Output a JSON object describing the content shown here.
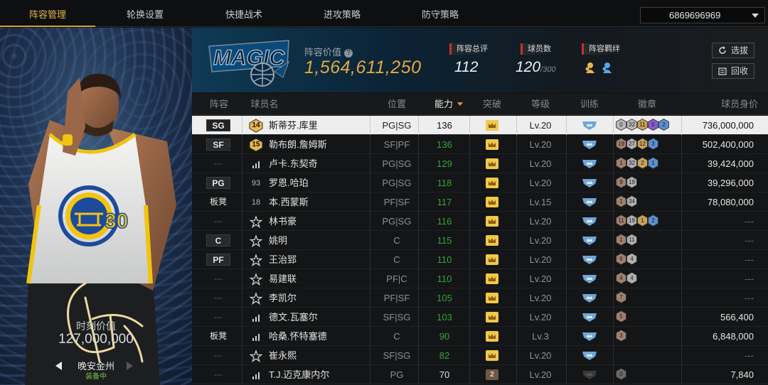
{
  "tabs": [
    {
      "label": "阵容管理",
      "active": true
    },
    {
      "label": "轮换设置",
      "active": false
    },
    {
      "label": "快捷战术",
      "active": false
    },
    {
      "label": "进攻策略",
      "active": false
    },
    {
      "label": "防守策略",
      "active": false
    }
  ],
  "account": {
    "id": "6869696969"
  },
  "card": {
    "market_value_label": "时刻价值",
    "market_value": "127,000,000",
    "name": "晚安金州",
    "status": "装备中",
    "jersey_team": "GOLDEN STATE WARRIORS",
    "jersey_number": "30"
  },
  "team": {
    "logo_text": "MAGIC",
    "lineup_value_label": "阵容价值",
    "lineup_value": "1,564,611,250",
    "overall_label": "阵容总评",
    "overall": "112",
    "player_count_label": "球员数",
    "player_count": "120",
    "player_count_max": "/300",
    "bond_label": "阵容羁绊",
    "select_button": "选拔",
    "recycle_button": "回收"
  },
  "columns": {
    "lineup": "阵容",
    "name": "球员名",
    "position": "位置",
    "rating": "能力",
    "breakthrough": "突破",
    "level": "等级",
    "training": "训练",
    "badges": "徽章",
    "value": "球员身价"
  },
  "colors": {
    "accent_gold": "#e4a93e",
    "rating_green": "#36a43b",
    "active_tab": "#e3b64a",
    "equipped_green": "#7fc241"
  },
  "players": [
    {
      "lineup": "SG",
      "lineup_style": "box",
      "badge": "14",
      "badge_type": "jersey-gold",
      "name": "斯蒂芬.库里",
      "position": "PG|SG",
      "rating": "136",
      "bt": "gold",
      "level": "Lv.20",
      "badges": [
        {
          "n": "0",
          "c": "#b9b9b9"
        },
        {
          "n": "32",
          "c": "#b9b9b9"
        },
        {
          "n": "11",
          "c": "#c9a15a"
        },
        {
          "n": "5",
          "c": "#8a5cc9"
        },
        {
          "n": "2",
          "c": "#5b8fd0"
        }
      ],
      "price": "736,000,000",
      "selected": true
    },
    {
      "lineup": "SF",
      "lineup_style": "box",
      "badge": "15",
      "badge_type": "jersey-gold",
      "name": "勒布朗.詹姆斯",
      "position": "SF|PF",
      "rating": "136",
      "bt": "gold",
      "level": "Lv.20",
      "badges": [
        {
          "n": "19",
          "c": "#a08070"
        },
        {
          "n": "27",
          "c": "#b0b0b0"
        },
        {
          "n": "12",
          "c": "#c9a15a"
        },
        {
          "n": "3",
          "c": "#5b8fd0"
        }
      ],
      "price": "502,400,000"
    },
    {
      "lineup": "---",
      "lineup_style": "dash",
      "badge": "",
      "badge_type": "signal",
      "name": "卢卡.东契奇",
      "position": "PG|SG",
      "rating": "129",
      "bt": "gold",
      "level": "Lv.20",
      "badges": [
        {
          "n": "1",
          "c": "#a08070"
        },
        {
          "n": "32",
          "c": "#b0b0b0"
        },
        {
          "n": "2",
          "c": "#c9a15a"
        },
        {
          "n": "1",
          "c": "#5b8fd0"
        }
      ],
      "price": "39,424,000"
    },
    {
      "lineup": "PG",
      "lineup_style": "box",
      "badge": "93",
      "badge_type": "number",
      "name": "罗恩.哈珀",
      "position": "PG|SG",
      "rating": "118",
      "bt": "gold",
      "level": "Lv.20",
      "badges": [
        {
          "n": "9",
          "c": "#a08070"
        },
        {
          "n": "19",
          "c": "#b0b0b0"
        }
      ],
      "price": "39,296,000"
    },
    {
      "lineup": "板凳",
      "lineup_style": "text",
      "badge": "18",
      "badge_type": "number",
      "name": "本.西蒙斯",
      "position": "PF|SF",
      "rating": "117",
      "bt": "gold",
      "level": "Lv.15",
      "badges": [
        {
          "n": "1",
          "c": "#a08070"
        },
        {
          "n": "34",
          "c": "#b0b0b0"
        }
      ],
      "price": "78,080,000"
    },
    {
      "lineup": "---",
      "lineup_style": "dash",
      "badge": "",
      "badge_type": "star",
      "name": "林书豪",
      "position": "PG|SG",
      "rating": "116",
      "bt": "gold",
      "level": "Lv.20",
      "badges": [
        {
          "n": "11",
          "c": "#a08070"
        },
        {
          "n": "19",
          "c": "#b0b0b0"
        },
        {
          "n": "1",
          "c": "#c9a15a"
        },
        {
          "n": "2",
          "c": "#5b8fd0"
        }
      ],
      "price": "---"
    },
    {
      "lineup": "C",
      "lineup_style": "box",
      "badge": "",
      "badge_type": "star",
      "name": "姚明",
      "position": "C",
      "rating": "115",
      "bt": "gold",
      "level": "Lv.20",
      "badges": [
        {
          "n": "1",
          "c": "#a08070"
        },
        {
          "n": "11",
          "c": "#b0b0b0"
        }
      ],
      "price": "---"
    },
    {
      "lineup": "PF",
      "lineup_style": "box",
      "badge": "",
      "badge_type": "star",
      "name": "王治郅",
      "position": "C",
      "rating": "110",
      "bt": "gold",
      "level": "Lv.20",
      "badges": [
        {
          "n": "6",
          "c": "#a08070"
        },
        {
          "n": "4",
          "c": "#b0b0b0"
        }
      ],
      "price": "---"
    },
    {
      "lineup": "---",
      "lineup_style": "dash",
      "badge": "",
      "badge_type": "star",
      "name": "易建联",
      "position": "PF|C",
      "rating": "110",
      "bt": "gold",
      "level": "Lv.20",
      "badges": [
        {
          "n": "4",
          "c": "#a08070"
        },
        {
          "n": "4",
          "c": "#b0b0b0"
        }
      ],
      "price": "---"
    },
    {
      "lineup": "---",
      "lineup_style": "dash",
      "badge": "",
      "badge_type": "star",
      "name": "李凯尔",
      "position": "PF|SF",
      "rating": "105",
      "bt": "gold",
      "level": "Lv.20",
      "badges": [
        {
          "n": "7",
          "c": "#a08070"
        }
      ],
      "price": "---"
    },
    {
      "lineup": "---",
      "lineup_style": "dash",
      "badge": "",
      "badge_type": "signal",
      "name": "德文.瓦塞尔",
      "position": "SF|SG",
      "rating": "103",
      "bt": "gold",
      "level": "Lv.20",
      "badges": [
        {
          "n": "5",
          "c": "#a08070"
        }
      ],
      "price": "566,400"
    },
    {
      "lineup": "板凳",
      "lineup_style": "text",
      "badge": "",
      "badge_type": "signal",
      "name": "哈桑.怀特塞德",
      "position": "C",
      "rating": "90",
      "bt": "gold",
      "level": "Lv.3",
      "badges": [
        {
          "n": "3",
          "c": "#a08070"
        }
      ],
      "price": "6,848,000"
    },
    {
      "lineup": "---",
      "lineup_style": "dash",
      "badge": "",
      "badge_type": "star",
      "name": "崔永熙",
      "position": "SF|SG",
      "rating": "82",
      "bt": "gold",
      "level": "Lv.20",
      "badges": [],
      "price": "---"
    },
    {
      "lineup": "---",
      "lineup_style": "dash",
      "badge": "",
      "badge_type": "signal",
      "name": "T.J.迈克康内尔",
      "position": "PG",
      "rating": "70",
      "rating_style": "white",
      "bt": "bronze",
      "bt_label": "2",
      "level": "Lv.20",
      "badges": [
        {
          "n": "0",
          "c": "#6a6a6a"
        }
      ],
      "price": "7,840",
      "train_dim": true
    }
  ]
}
